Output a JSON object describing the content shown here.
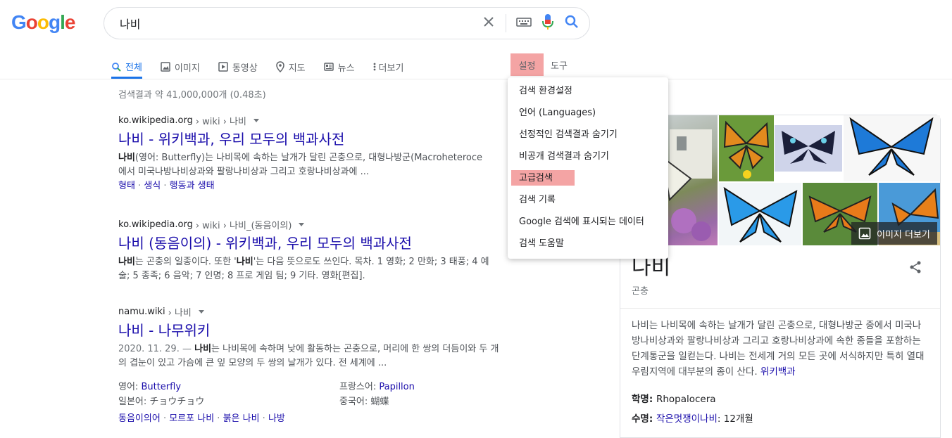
{
  "logo": {
    "letters": [
      "G",
      "o",
      "o",
      "g",
      "l",
      "e"
    ],
    "colors": [
      "#4285F4",
      "#EA4335",
      "#FBBC05",
      "#4285F4",
      "#34A853",
      "#EA4335"
    ]
  },
  "search": {
    "query": "나비"
  },
  "tabs": [
    {
      "label": "전체",
      "icon": "search-icon"
    },
    {
      "label": "이미지",
      "icon": "image-icon"
    },
    {
      "label": "동영상",
      "icon": "video-icon"
    },
    {
      "label": "지도",
      "icon": "map-pin-icon"
    },
    {
      "label": "뉴스",
      "icon": "news-icon"
    },
    {
      "label": "더보기",
      "icon": "more-vert-icon"
    }
  ],
  "settings_label": "설정",
  "tools_label": "도구",
  "stats": "검색결과 약 41,000,000개 (0.48초)",
  "dropdown": [
    "검색 환경설정",
    "언어 (Languages)",
    "선정적인 검색결과 숨기기",
    "비공개 검색결과 숨기기",
    "고급검색",
    "검색 기록",
    "Google 검색에 표시되는 데이터",
    "검색 도움말"
  ],
  "results": [
    {
      "domain": "ko.wikipedia.org",
      "path": " › wiki › 나비",
      "title": "나비 - 위키백과, 우리 모두의 백과사전",
      "snippet_bold": "나비",
      "snippet_line1": "(영어: Butterfly)는 나비목에 속하는 날개가 달린 곤충으로, 대형나방군(Macroheteroce",
      "snippet_line2": "에서 미국나방나비상과와 팔랑나비상과 그리고 호랑나비상과에 ...",
      "sitelinks": [
        "형태",
        "생식",
        "행동과 생태"
      ]
    },
    {
      "domain": "ko.wikipedia.org",
      "path": " › wiki › 나비_(동음이의)",
      "title": "나비 (동음이의) - 위키백과, 우리 모두의 백과사전",
      "snippet_bold": "나비",
      "snippet_mid": "는 곤충의 일종이다. 또한 '",
      "snippet_bold2": "나비",
      "snippet_line1": "'는 다음 뜻으로도 쓰인다. 목차. 1 영화; 2 만화; 3 태풍; 4 예",
      "snippet_line2": "술; 5 종족; 6 음악; 7 인명; 8 프로 게임 팀; 9 기타. 영화[편집]."
    },
    {
      "domain": "namu.wiki",
      "path": " › 나비",
      "title": "나비 - 나무위키",
      "date": "2020. 11. 29. — ",
      "snippet_bold": "나비",
      "snippet_line1": "는 나비목에 속하며 낮에 활동하는 곤충으로, 머리에 한 쌍의 더듬이와 두 개",
      "snippet_line2": "의 겹눈이 있고 가슴에 큰 잎 모양의 두 쌍의 날개가 있다. 전 세계에 ...",
      "facts": [
        {
          "k": "영어: ",
          "v": "Butterfly"
        },
        {
          "k": "프랑스어: ",
          "v": "Papillon"
        },
        {
          "k": "일본어: ",
          "v": "チョウチョウ"
        },
        {
          "k": "중국어: ",
          "v": "蝴蝶"
        }
      ],
      "sitelinks": [
        "동음이의어",
        "모르포 나비",
        "붉은 나비",
        "나방"
      ]
    }
  ],
  "kp": {
    "more_images": "이미지 더보기",
    "title": "나비",
    "subtitle": "곤충",
    "description": "나비는 나비목에 속하는 날개가 달린 곤충으로, 대형나방군 중에서 미국나방나비상과와 팔랑나비상과 그리고 호랑나비상과에 속한 종들을 포함하는 단계통군을 일컫는다. 나비는 전세계 거의 모든 곳에 서식하지만 특히 열대우림지역에 대부분의 종이 산다.",
    "source": "위키백과",
    "fact1_k": "학명: ",
    "fact1_v": "Rhopalocera",
    "fact2_k": "수명: ",
    "fact2_link": "작은멋쟁이나비",
    "fact2_v": ": 12개월"
  }
}
